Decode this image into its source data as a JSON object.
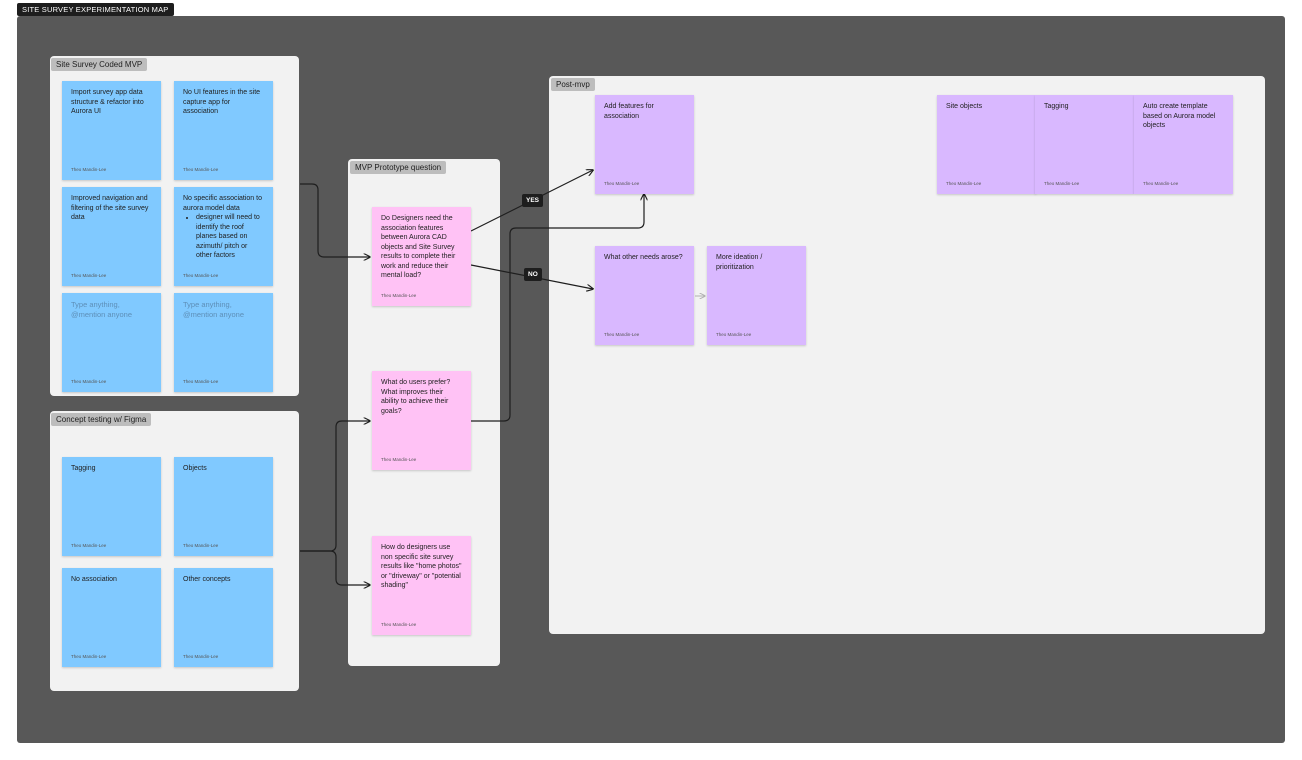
{
  "page_title": "SITE SURVEY EXPERIMENTATION MAP",
  "sections": {
    "coded_mvp": "Site Survey Coded MVP",
    "concept_testing": "Concept testing w/ Figma",
    "mvp_question": "MVP Prototype question",
    "post_mvp": "Post-mvp"
  },
  "author": "Theo Mandin-Lee",
  "stickies": {
    "coded_1": "Import survey app data structure & refactor into Aurora UI",
    "coded_2": "No UI features in the site capture app for association",
    "coded_3": "Improved navigation and filtering of the site survey data",
    "coded_4": "No specific association to aurora model data",
    "coded_4_bullet": "designer will need to identify the roof planes based on azimuth/ pitch or other factors",
    "coded_5": "Type anything, @mention anyone",
    "coded_6": "Type anything, @mention anyone",
    "concept_1": "Tagging",
    "concept_2": "Objects",
    "concept_3": "No association",
    "concept_4": "Other concepts",
    "question_1": "Do Designers need the association features between Aurora CAD objects and Site Survey results to complete their work and reduce their mental load?",
    "question_2": "What do users prefer? What improves their ability to achieve their goals?",
    "question_3": "How do designers use non specific site survey results like \"home photos\" or \"driveway\" or \"potential shading\"",
    "post_1": "Add features for association",
    "post_2": "Site objects",
    "post_3": "Tagging",
    "post_4": "Auto create template based on Aurora model objects",
    "post_5": "What other needs arose?",
    "post_6": "More ideation  / prioritization"
  },
  "badges": {
    "yes": "YES",
    "no": "NO"
  },
  "colors": {
    "canvas": "#585858",
    "section": "#f2f2f2",
    "sticky_blue": "#80c9ff",
    "sticky_pink": "#ffc2f5",
    "sticky_purple": "#d9b8ff",
    "connector": "#1e1e1e"
  }
}
